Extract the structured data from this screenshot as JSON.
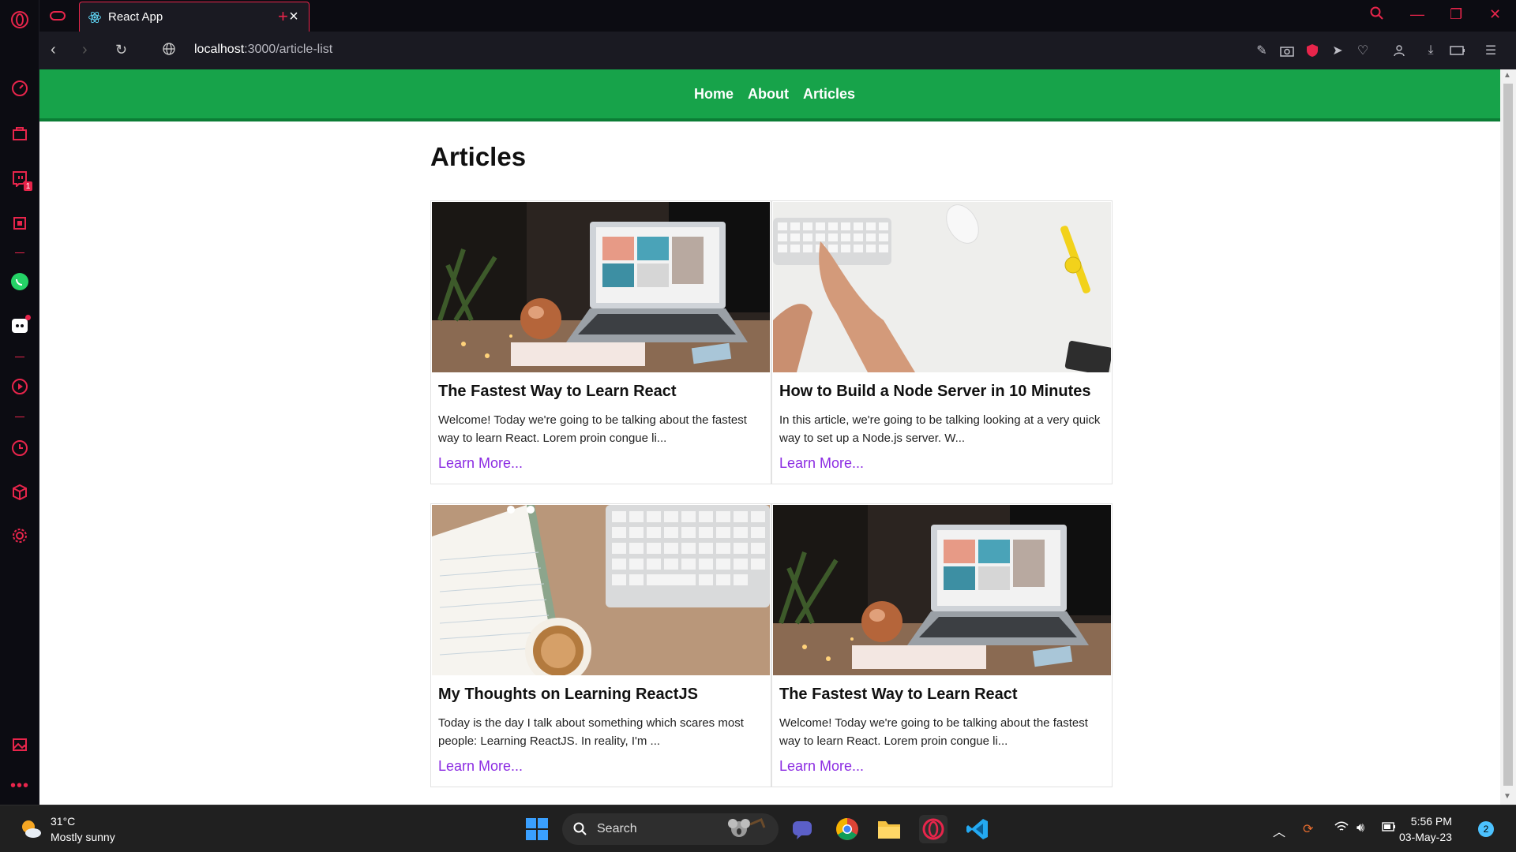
{
  "browser": {
    "tab_title": "React App",
    "url_host": "localhost",
    "url_path": ":3000/article-list",
    "accent": "#e8254b",
    "sidebar_badge": "1"
  },
  "site": {
    "nav": [
      "Home",
      "About",
      "Articles"
    ],
    "heading": "Articles",
    "accent": "#17a34a",
    "link_color": "#8b2be2"
  },
  "articles": [
    {
      "title": "The Fastest Way to Learn React",
      "desc": "Welcome! Today we're going to be talking about the fastest way to learn React. Lorem proin congue li...",
      "link": "Learn More...",
      "image": "laptop-on-desk"
    },
    {
      "title": "How to Build a Node Server in 10 Minutes",
      "desc": "In this article, we're going to be talking looking at a very quick way to set up a Node.js server. W...",
      "link": "Learn More...",
      "image": "hands-on-keyboard"
    },
    {
      "title": "My Thoughts on Learning ReactJS",
      "desc": "Today is the day I talk about something which scares most people: Learning ReactJS. In reality, I'm ...",
      "link": "Learn More...",
      "image": "notebook-coffee-keyboard"
    },
    {
      "title": "The Fastest Way to Learn React",
      "desc": "Welcome! Today we're going to be talking about the fastest way to learn React. Lorem proin congue li...",
      "link": "Learn More...",
      "image": "laptop-on-desk"
    }
  ],
  "taskbar": {
    "temp": "31°C",
    "weather": "Mostly sunny",
    "search_label": "Search",
    "time": "5:56 PM",
    "date": "03-May-23",
    "notifications": "2"
  }
}
